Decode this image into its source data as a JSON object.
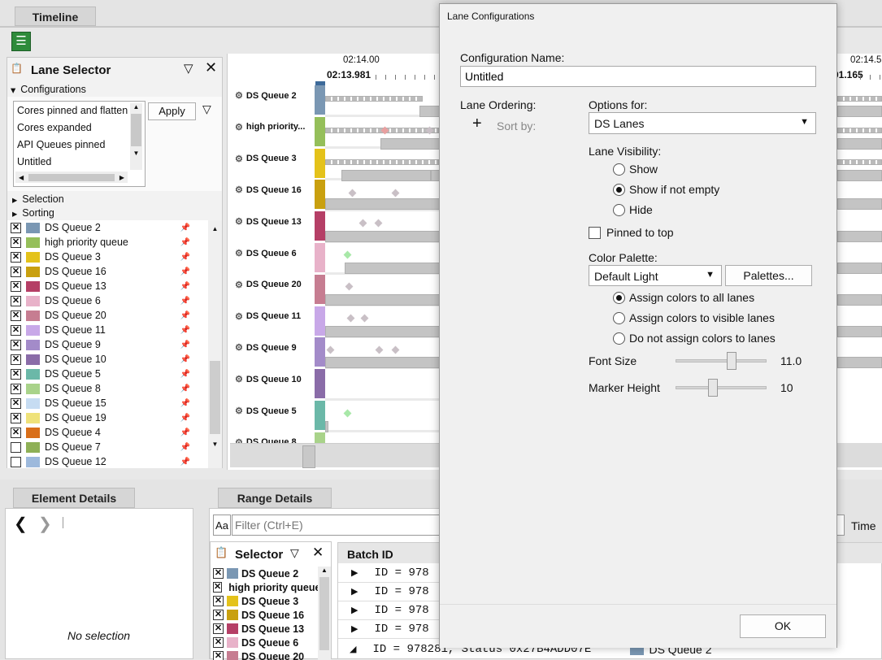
{
  "timeline": {
    "tab": "Timeline",
    "t_left": "02:14.00",
    "t_left_sel": "02:13.981",
    "t_right": "02:14.5",
    "t_right_sel": "01.165"
  },
  "lane_selector": {
    "title": "Lane Selector",
    "configs_label": "Configurations",
    "configs": [
      "Cores pinned and flatten",
      "Cores expanded",
      "API Queues pinned",
      "Untitled"
    ],
    "apply": "Apply",
    "selection": "Selection",
    "sorting": "Sorting",
    "lanes": [
      {
        "name": "DS Queue 2",
        "color": "#7a97b3",
        "checked": true
      },
      {
        "name": "high priority queue",
        "color": "#95bf5a",
        "checked": true
      },
      {
        "name": "DS Queue 3",
        "color": "#e4c21a",
        "checked": true
      },
      {
        "name": "DS Queue 16",
        "color": "#c9a00f",
        "checked": true
      },
      {
        "name": "DS Queue 13",
        "color": "#b53f66",
        "checked": true
      },
      {
        "name": "DS Queue 6",
        "color": "#e8b2c9",
        "checked": true
      },
      {
        "name": "DS Queue 20",
        "color": "#c67d91",
        "checked": true
      },
      {
        "name": "DS Queue 11",
        "color": "#c8a8e8",
        "checked": true
      },
      {
        "name": "DS Queue 9",
        "color": "#a38bc9",
        "checked": true
      },
      {
        "name": "DS Queue 10",
        "color": "#8a6ca8",
        "checked": true
      },
      {
        "name": "DS Queue 5",
        "color": "#6bb8a8",
        "checked": true
      },
      {
        "name": "DS Queue 8",
        "color": "#a9d38a",
        "checked": true
      },
      {
        "name": "DS Queue 15",
        "color": "#c6dcf2",
        "checked": true
      },
      {
        "name": "DS Queue 19",
        "color": "#efe27a",
        "checked": true
      },
      {
        "name": "DS Queue 4",
        "color": "#d96f1a",
        "checked": true
      },
      {
        "name": "DS Queue 7",
        "color": "#8eb056",
        "checked": false
      },
      {
        "name": "DS Queue 12",
        "color": "#9db9dc",
        "checked": false
      }
    ]
  },
  "timeline_lanes": [
    {
      "name": "DS Queue 2",
      "color": "#7a97b3"
    },
    {
      "name": "high priority...",
      "color": "#95bf5a"
    },
    {
      "name": "DS Queue 3",
      "color": "#e4c21a"
    },
    {
      "name": "DS Queue 16",
      "color": "#c9a00f"
    },
    {
      "name": "DS Queue 13",
      "color": "#b53f66"
    },
    {
      "name": "DS Queue 6",
      "color": "#e8b2c9"
    },
    {
      "name": "DS Queue 20",
      "color": "#c67d91"
    },
    {
      "name": "DS Queue 11",
      "color": "#c8a8e8"
    },
    {
      "name": "DS Queue 9",
      "color": "#a38bc9"
    },
    {
      "name": "DS Queue 10",
      "color": "#8a6ca8"
    },
    {
      "name": "DS Queue 5",
      "color": "#6bb8a8"
    },
    {
      "name": "DS Queue 8",
      "color": "#a9d38a"
    }
  ],
  "element_details": {
    "tab": "Element Details",
    "empty": "No selection"
  },
  "range_details": {
    "tab": "Range Details",
    "filter_placeholder": "Filter (Ctrl+E)",
    "aa": "Aa",
    "time": "Time",
    "selector_title": "Selector",
    "batch_header": "Batch ID",
    "selector_rows": [
      "DS Queue 2",
      "high priority queue",
      "DS Queue 3",
      "DS Queue 16",
      "DS Queue 13",
      "DS Queue 6",
      "DS Queue 20"
    ],
    "rows": [
      "ID = 978",
      "ID = 978",
      "ID = 978",
      "ID = 978"
    ],
    "last_row": "ID = 978281, Status 0x27B4ADD07E",
    "last_lane": "DS Queue 2"
  },
  "dialog": {
    "title": "Lane Configurations",
    "config_name_label": "Configuration Name:",
    "config_name": "Untitled",
    "lane_ordering": "Lane Ordering:",
    "sort_by": "Sort by:",
    "options_for": "Options for:",
    "options_value": "DS Lanes",
    "lane_visibility": "Lane Visibility:",
    "vis_options": [
      "Show",
      "Show if not empty",
      "Hide"
    ],
    "vis_selected": 1,
    "pinned": "Pinned to top",
    "color_palette": "Color Palette:",
    "palette_value": "Default Light",
    "palettes_btn": "Palettes...",
    "assign_options": [
      "Assign colors to all lanes",
      "Assign colors to visible lanes",
      "Do not assign colors to lanes"
    ],
    "assign_selected": 0,
    "font_size_label": "Font Size",
    "font_size": "11.0",
    "marker_height_label": "Marker Height",
    "marker_height": "10",
    "ok": "OK"
  }
}
